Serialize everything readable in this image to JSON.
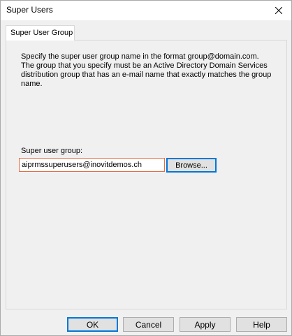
{
  "window": {
    "title": "Super Users",
    "close_icon": "close-icon"
  },
  "tabs": [
    {
      "label": "Super User Group",
      "selected": true
    }
  ],
  "panel": {
    "description": "Specify the super user group name in the format group@domain.com. The group that you specify must be an Active Directory Domain Services distribution group that has an e-mail name that exactly matches the group name.",
    "field_label": "Super user group:",
    "group_value": "aiprmssuperusers@inovitdemos.ch",
    "browse_label": "Browse..."
  },
  "buttons": {
    "ok": "OK",
    "cancel": "Cancel",
    "apply": "Apply",
    "help": "Help"
  },
  "colors": {
    "accent": "#0078d7",
    "input_border": "#e26f45",
    "button_face": "#e1e1e1",
    "dialog_bg": "#f0f0f0"
  }
}
